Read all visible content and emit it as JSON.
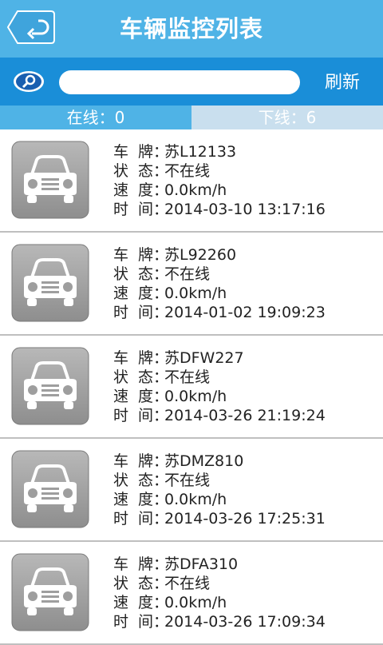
{
  "header": {
    "title": "车辆监控列表"
  },
  "search": {
    "placeholder": "",
    "value": "",
    "refresh_label": "刷新"
  },
  "tabs": {
    "online": "在线：0",
    "offline": "下线：6"
  },
  "labels": {
    "plate": [
      "车",
      "牌"
    ],
    "status": [
      "状",
      "态"
    ],
    "speed": [
      "速",
      "度"
    ],
    "time": [
      "时",
      "间"
    ],
    "separator": "："
  },
  "vehicles": [
    {
      "plate": "苏L12133",
      "status": "不在线",
      "speed": "0.0km/h",
      "time": "2014-03-10 13:17:16"
    },
    {
      "plate": "苏L92260",
      "status": "不在线",
      "speed": "0.0km/h",
      "time": "2014-01-02 19:09:23"
    },
    {
      "plate": "苏DFW227",
      "status": "不在线",
      "speed": "0.0km/h",
      "time": "2014-03-26 21:19:24"
    },
    {
      "plate": "苏DMZ810",
      "status": "不在线",
      "speed": "0.0km/h",
      "time": "2014-03-26 17:25:31"
    },
    {
      "plate": "苏DFA310",
      "status": "不在线",
      "speed": "0.0km/h",
      "time": "2014-03-26 17:09:34"
    }
  ],
  "colors": {
    "header_bg": "#4fb3e6",
    "searchbar_bg": "#1a8ed8",
    "tab_online_bg": "#4fb3e6",
    "tab_offline_bg": "#c9dfee"
  }
}
